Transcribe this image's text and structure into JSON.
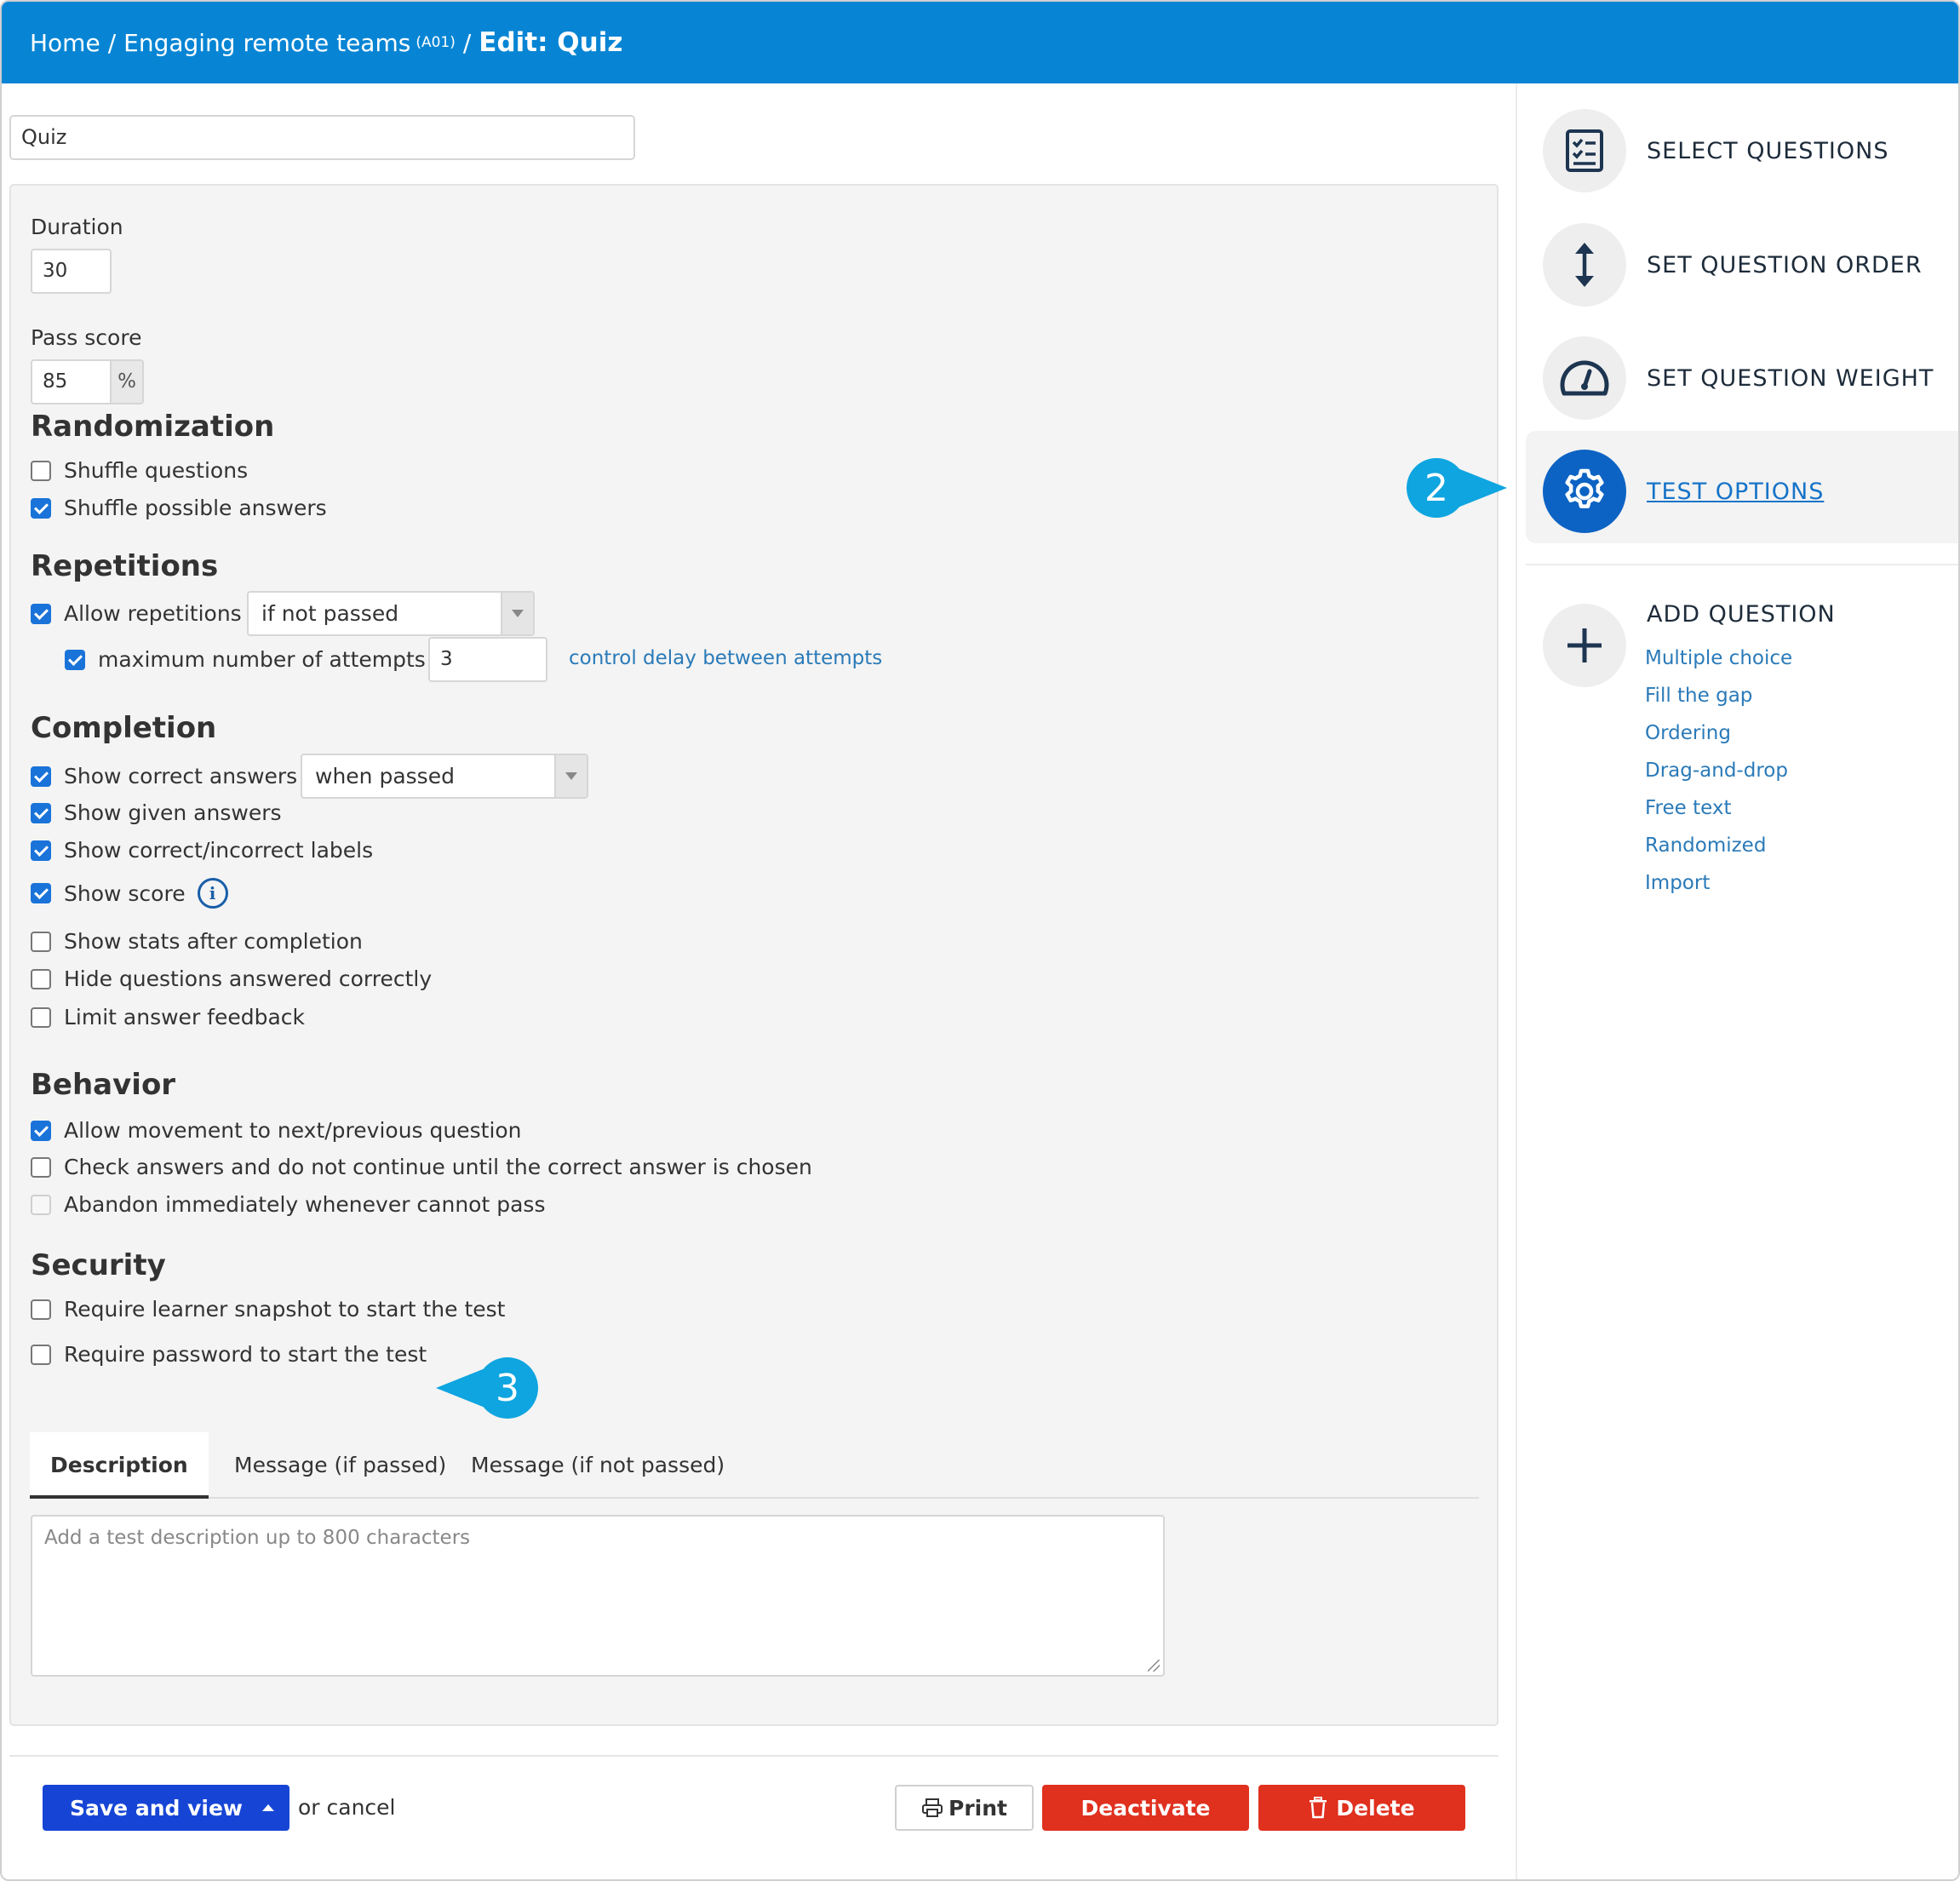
{
  "breadcrumb": {
    "home": "Home",
    "course": "Engaging remote teams",
    "course_code": "(A01)",
    "separator": "/",
    "current": "Edit: Quiz"
  },
  "title_value": "Quiz",
  "duration": {
    "label": "Duration",
    "value": "30"
  },
  "pass_score": {
    "label": "Pass score",
    "value": "85",
    "unit": "%"
  },
  "randomization": {
    "heading": "Randomization",
    "shuffle_questions": {
      "label": "Shuffle questions",
      "checked": false
    },
    "shuffle_answers": {
      "label": "Shuffle possible answers",
      "checked": true
    }
  },
  "repetitions": {
    "heading": "Repetitions",
    "allow": {
      "label": "Allow repetitions",
      "checked": true,
      "select": "if not passed"
    },
    "max_attempts": {
      "label": "maximum number of attempts",
      "checked": true,
      "value": "3"
    },
    "delay_link": "control delay between attempts"
  },
  "completion": {
    "heading": "Completion",
    "show_correct": {
      "label": "Show correct answers",
      "checked": true,
      "select": "when passed"
    },
    "show_given": {
      "label": "Show given answers",
      "checked": true
    },
    "show_labels": {
      "label": "Show correct/incorrect labels",
      "checked": true
    },
    "show_score": {
      "label": "Show score",
      "checked": true
    },
    "show_stats": {
      "label": "Show stats after completion",
      "checked": false
    },
    "hide_correct": {
      "label": "Hide questions answered correctly",
      "checked": false
    },
    "limit_feedback": {
      "label": "Limit answer feedback",
      "checked": false
    }
  },
  "behavior": {
    "heading": "Behavior",
    "allow_movement": {
      "label": "Allow movement to next/previous question",
      "checked": true
    },
    "check_answers": {
      "label": "Check answers and do not continue until the correct answer is chosen",
      "checked": false
    },
    "abandon": {
      "label": "Abandon immediately whenever cannot pass",
      "checked": false,
      "disabled": true
    }
  },
  "security": {
    "heading": "Security",
    "snapshot": {
      "label": "Require learner snapshot to start the test",
      "checked": false
    },
    "password": {
      "label": "Require password to start the test",
      "checked": false
    }
  },
  "tabs": [
    "Description",
    "Message (if passed)",
    "Message (if not passed)"
  ],
  "description_placeholder": "Add a test description up to 800 characters",
  "footer": {
    "save": "Save and view",
    "or_cancel": "or cancel",
    "print": "Print",
    "deactivate": "Deactivate",
    "delete": "Delete"
  },
  "sidebar": {
    "select_questions": "SELECT QUESTIONS",
    "set_order": "SET QUESTION ORDER",
    "set_weight": "SET QUESTION WEIGHT",
    "test_options": "TEST OPTIONS",
    "add_question": "ADD QUESTION",
    "add_types": [
      "Multiple choice",
      "Fill the gap",
      "Ordering",
      "Drag-and-drop",
      "Free text",
      "Randomized",
      "Import"
    ]
  },
  "callouts": {
    "two": "2",
    "three": "3"
  },
  "colors": {
    "header": "#0785d4",
    "primary": "#1645d6",
    "danger": "#e0301e",
    "callout": "#0ea5e0",
    "link": "#2a7ab8"
  }
}
